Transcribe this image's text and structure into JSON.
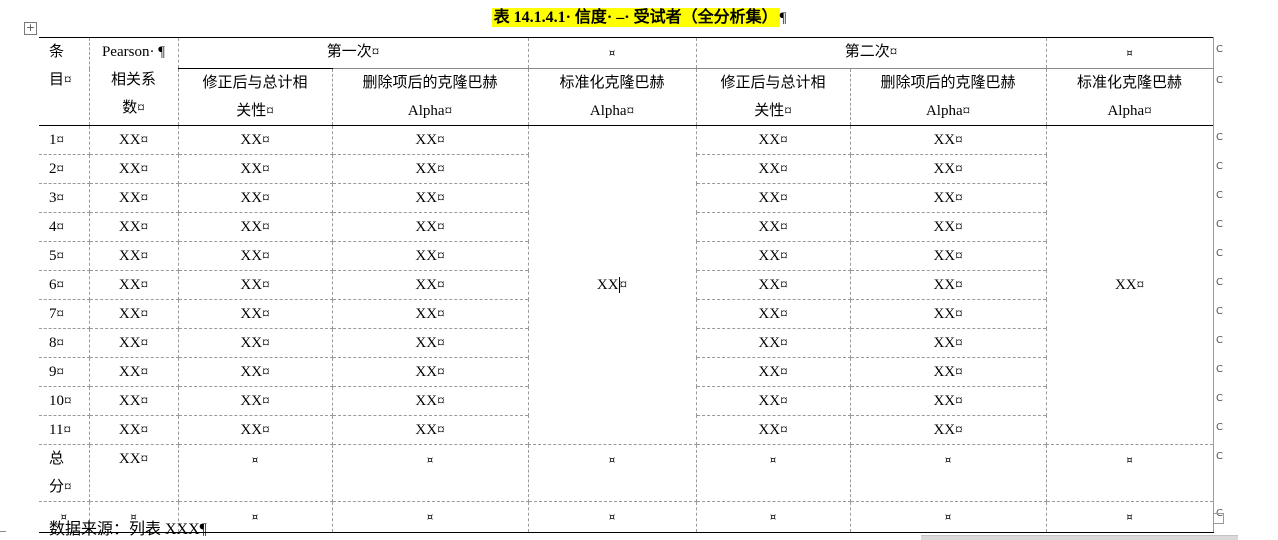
{
  "title": "表 14.1.4.1· 信度· –· 受试者（全分析集）",
  "pilcrow": "¶",
  "cell_mark": "¤",
  "header": {
    "item": [
      "条",
      "目¤"
    ],
    "pearson": [
      "Pearson· ¶",
      "相关系",
      "数¤"
    ],
    "first": "第一次¤",
    "blank": "¤",
    "second": "第二次¤",
    "corrected": [
      "修正后与总计相",
      "关性¤"
    ],
    "alpha_deleted": [
      "删除项后的克隆巴赫",
      "Alpha¤"
    ],
    "alpha_std": [
      "标准化克隆巴赫",
      "Alpha¤"
    ]
  },
  "rows": [
    {
      "item": "1¤",
      "pearson": "XX¤",
      "c1": "XX¤",
      "a1": "XX¤",
      "c2": "XX¤",
      "a2": "XX¤"
    },
    {
      "item": "2¤",
      "pearson": "XX¤",
      "c1": "XX¤",
      "a1": "XX¤",
      "c2": "XX¤",
      "a2": "XX¤"
    },
    {
      "item": "3¤",
      "pearson": "XX¤",
      "c1": "XX¤",
      "a1": "XX¤",
      "c2": "XX¤",
      "a2": "XX¤"
    },
    {
      "item": "4¤",
      "pearson": "XX¤",
      "c1": "XX¤",
      "a1": "XX¤",
      "c2": "XX¤",
      "a2": "XX¤"
    },
    {
      "item": "5¤",
      "pearson": "XX¤",
      "c1": "XX¤",
      "a1": "XX¤",
      "c2": "XX¤",
      "a2": "XX¤"
    },
    {
      "item": "6¤",
      "pearson": "XX¤",
      "c1": "XX¤",
      "a1": "XX¤",
      "c2": "XX¤",
      "a2": "XX¤"
    },
    {
      "item": "7¤",
      "pearson": "XX¤",
      "c1": "XX¤",
      "a1": "XX¤",
      "c2": "XX¤",
      "a2": "XX¤"
    },
    {
      "item": "8¤",
      "pearson": "XX¤",
      "c1": "XX¤",
      "a1": "XX¤",
      "c2": "XX¤",
      "a2": "XX¤"
    },
    {
      "item": "9¤",
      "pearson": "XX¤",
      "c1": "XX¤",
      "a1": "XX¤",
      "c2": "XX¤",
      "a2": "XX¤"
    },
    {
      "item": "10¤",
      "pearson": "XX¤",
      "c1": "XX¤",
      "a1": "XX¤",
      "c2": "XX¤",
      "a2": "XX¤"
    },
    {
      "item": "11¤",
      "pearson": "XX¤",
      "c1": "XX¤",
      "a1": "XX¤",
      "c2": "XX¤",
      "a2": "XX¤"
    }
  ],
  "merged_alpha_first": "XX",
  "merged_alpha_first_mark": "¤",
  "merged_alpha_second": "XX¤",
  "total": {
    "item": [
      "总",
      "分¤"
    ],
    "pearson": "XX¤",
    "blank": "¤"
  },
  "footnote": "数据来源：列表 XXX¶"
}
